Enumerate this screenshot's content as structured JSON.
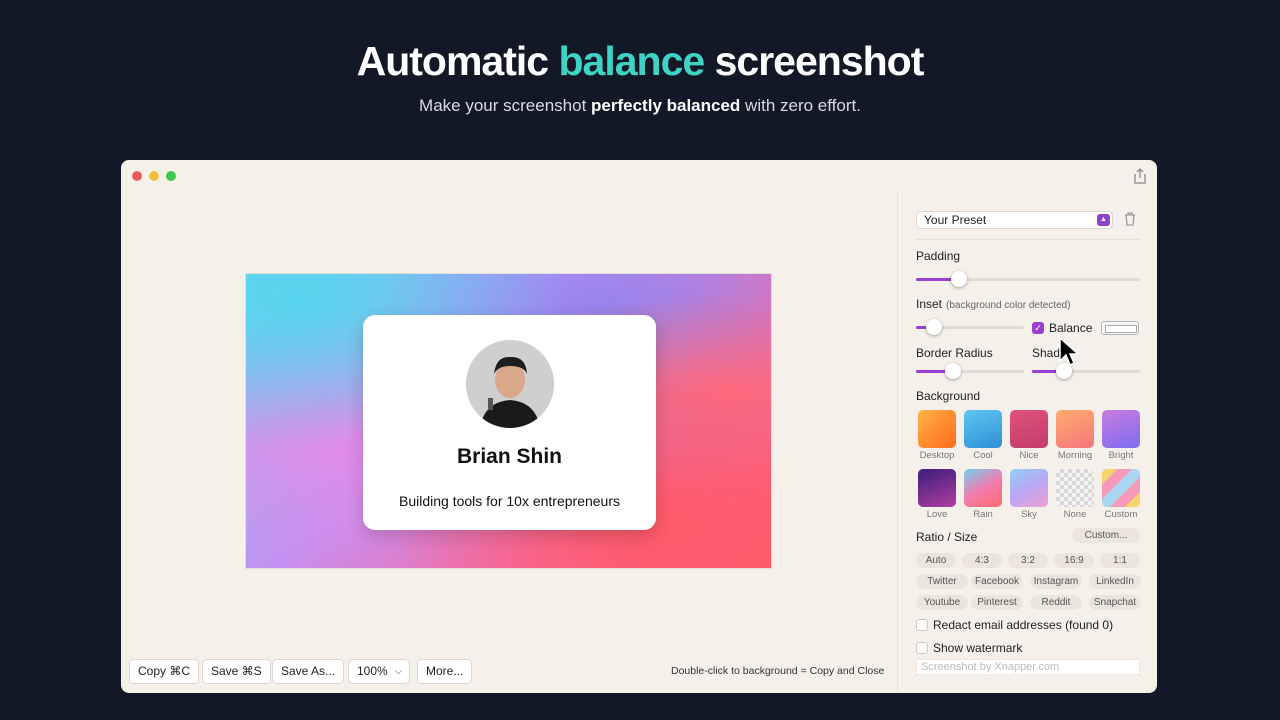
{
  "hero": {
    "title_pre": "Automatic",
    "title_accent": "balance",
    "title_post": "screenshot",
    "sub_pre": "Make your screenshot",
    "sub_bold": "perfectly balanced",
    "sub_post": "with zero effort."
  },
  "card": {
    "name": "Brian Shin",
    "bio": "Building tools for 10x entrepreneurs"
  },
  "toolbar": {
    "copy": "Copy ⌘C",
    "save": "Save ⌘S",
    "save_as": "Save As...",
    "zoom": "100%",
    "more": "More...",
    "hint": "Double-click to background = Copy and Close"
  },
  "sidebar": {
    "preset": "Your Preset",
    "padding_label": "Padding",
    "padding_value": 0.19,
    "inset_label": "Inset",
    "inset_note": "(background color detected)",
    "inset_value": 0.17,
    "balance_label": "Balance",
    "balance_checked": true,
    "border_radius_label": "Border Radius",
    "border_radius_value": 0.34,
    "shadow_label": "Shado",
    "shadow_value": 0.3,
    "background_label": "Background",
    "backgrounds": [
      {
        "name": "Desktop",
        "color": "#ff9a3c"
      },
      {
        "name": "Cool",
        "color": "#3aa9e0"
      },
      {
        "name": "Nice",
        "color": "#d9476f"
      },
      {
        "name": "Morning",
        "color": "#f9936f"
      },
      {
        "name": "Bright",
        "color": "#a06ae6"
      },
      {
        "name": "Love",
        "color": "#6d2f9c"
      },
      {
        "name": "Rain",
        "color": "#f27aa5"
      },
      {
        "name": "Sky",
        "color": "#9cc9f5"
      },
      {
        "name": "None",
        "color": "#e6e6e6"
      },
      {
        "name": "Custom",
        "color": "#f5a2c0"
      }
    ],
    "ratio_label": "Ratio / Size",
    "custom_button": "Custom...",
    "ratios": [
      "Auto",
      "4:3",
      "3:2",
      "16:9",
      "1:1"
    ],
    "socials_1": [
      "Twitter",
      "Facebook",
      "Instagram",
      "LinkedIn"
    ],
    "socials_2": [
      "Youtube",
      "Pinterest",
      "Reddit",
      "Snapchat"
    ],
    "redact_label": "Redact email addresses (found 0)",
    "watermark_label": "Show watermark",
    "watermark_placeholder": "Screenshot by Xnapper.com"
  }
}
